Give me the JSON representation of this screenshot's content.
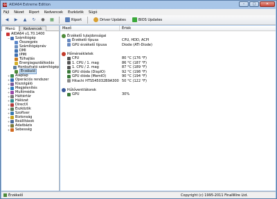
{
  "window": {
    "title": "AIDA64 Extreme Edition"
  },
  "menu": [
    "Fájl",
    "Nézet",
    "Riport",
    "Kedvencek",
    "Eszközök",
    "Súgó"
  ],
  "toolbar": {
    "report_label": "Riport",
    "driver_label": "Driver Updates",
    "bios_label": "BIOS Updates"
  },
  "left": {
    "tabs": [
      "Menü",
      "Kedvencek"
    ],
    "tree": [
      {
        "label": "AIDA64 v1.70.1400",
        "indent": 0,
        "expander": "",
        "color": "#c33",
        "icon": "aida64-icon"
      },
      {
        "label": "Számítógép",
        "indent": 1,
        "expander": "−",
        "color": "#4a74b8",
        "icon": "computer-icon"
      },
      {
        "label": "Összegzés",
        "indent": 2,
        "expander": "",
        "color": "#5b87c9",
        "icon": "summary-icon"
      },
      {
        "label": "Számítógépnév",
        "indent": 2,
        "expander": "",
        "color": "#6b8fbf",
        "icon": "computer-name-icon"
      },
      {
        "label": "DMI",
        "indent": 2,
        "expander": "",
        "color": "#3e6fb0",
        "icon": "dmi-icon"
      },
      {
        "label": "IPMI",
        "indent": 2,
        "expander": "",
        "color": "#3e6fb0",
        "icon": "ipmi-icon"
      },
      {
        "label": "Túlhajtás",
        "indent": 2,
        "expander": "",
        "color": "#c97a1e",
        "icon": "overclock-icon"
      },
      {
        "label": "Energiagazdálkodás",
        "indent": 2,
        "expander": "",
        "color": "#d4b02a",
        "icon": "power-icon"
      },
      {
        "label": "Hordozható számítógép",
        "indent": 2,
        "expander": "",
        "color": "#5f7f9f",
        "icon": "laptop-icon"
      },
      {
        "label": "Érzékelő",
        "indent": 2,
        "expander": "",
        "color": "#4d8a3a",
        "icon": "sensor-icon",
        "selected": true
      },
      {
        "label": "Alaplap",
        "indent": 1,
        "expander": "+",
        "color": "#3d8a4f",
        "icon": "motherboard-icon"
      },
      {
        "label": "Operációs rendszer",
        "indent": 1,
        "expander": "+",
        "color": "#2f6db5",
        "icon": "os-icon"
      },
      {
        "label": "Kiszolgáló",
        "indent": 1,
        "expander": "+",
        "color": "#7a5a9a",
        "icon": "server-icon"
      },
      {
        "label": "Megjelenítés",
        "indent": 1,
        "expander": "+",
        "color": "#2f7fc2",
        "icon": "display-icon"
      },
      {
        "label": "Multimédia",
        "indent": 1,
        "expander": "+",
        "color": "#9a4aa8",
        "icon": "multimedia-icon"
      },
      {
        "label": "Háttértár",
        "indent": 1,
        "expander": "+",
        "color": "#777777",
        "icon": "storage-icon"
      },
      {
        "label": "Hálózat",
        "indent": 1,
        "expander": "+",
        "color": "#2f8f8f",
        "icon": "network-icon"
      },
      {
        "label": "DirectX",
        "indent": 1,
        "expander": "+",
        "color": "#b03a3a",
        "icon": "directx-icon"
      },
      {
        "label": "Eszközök",
        "indent": 1,
        "expander": "+",
        "color": "#5a7a5a",
        "icon": "devices-icon"
      },
      {
        "label": "Szoftver",
        "indent": 1,
        "expander": "+",
        "color": "#3a7ab0",
        "icon": "software-icon"
      },
      {
        "label": "Biztonság",
        "indent": 1,
        "expander": "+",
        "color": "#c9a51e",
        "icon": "security-icon"
      },
      {
        "label": "Beállítások",
        "indent": 1,
        "expander": "+",
        "color": "#4a6a9a",
        "icon": "settings-icon"
      },
      {
        "label": "Adatbázis",
        "indent": 1,
        "expander": "+",
        "color": "#7a7a3a",
        "icon": "database-icon"
      },
      {
        "label": "Sebesség",
        "indent": 1,
        "expander": "+",
        "color": "#d2691e",
        "icon": "benchmark-icon"
      }
    ]
  },
  "right": {
    "columns": [
      "Mező",
      "Érték"
    ],
    "sections": [
      {
        "title": "Érzékelő tulajdonságai",
        "icon": "sensor-props-icon",
        "color": "#4d8a3a",
        "rows": [
          {
            "field": "Érzékelő típusa",
            "value": "CPU, HDD, ACPI",
            "color": "#6a8ac0",
            "icon": "sensor-type-icon"
          },
          {
            "field": "GPU érzékelő típusa",
            "value": "Diode (ATI-Diode)",
            "color": "#6a8ac0",
            "icon": "gpu-sensor-icon"
          }
        ]
      },
      {
        "title": "Hőmérsékletek",
        "icon": "temperature-icon",
        "color": "#c23a2a",
        "rows": [
          {
            "field": "CPU",
            "value": "80 °C  (176 °F)",
            "color": "#555555",
            "icon": "cpu-icon"
          },
          {
            "field": "1. CPU / 1. mag",
            "value": "86 °C  (187 °F)",
            "color": "#555555",
            "icon": "cpu-core-icon"
          },
          {
            "field": "1. CPU / 2. mag",
            "value": "87 °C  (189 °F)",
            "color": "#555555",
            "icon": "cpu-core-icon"
          },
          {
            "field": "GPU dióda (DispIO)",
            "value": "92 °C  (198 °F)",
            "color": "#3a7a3a",
            "icon": "gpu-icon"
          },
          {
            "field": "GPU dióda (MemIO)",
            "value": "90 °C  (194 °F)",
            "color": "#3a7a3a",
            "icon": "gpu-icon"
          },
          {
            "field": "Hitachi HTS545032B9A300",
            "value": "50 °C  (122 °F)",
            "color": "#888888",
            "icon": "hdd-icon"
          }
        ]
      },
      {
        "title": "Hűtőventilátorok",
        "icon": "fan-icon",
        "color": "#3a5a9a",
        "rows": [
          {
            "field": "GPU",
            "value": "30%",
            "color": "#3a7a3a",
            "icon": "gpu-icon"
          }
        ]
      }
    ]
  },
  "status": {
    "left": "Érzékelő",
    "right": "Copyright (c) 1995-2011 FinalWire Ltd."
  }
}
